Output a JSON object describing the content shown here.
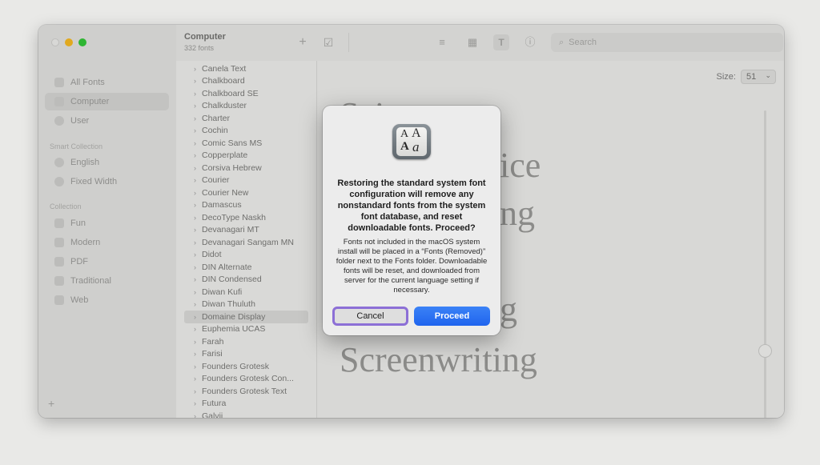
{
  "sidebar": {
    "items": [
      {
        "label": "All Fonts"
      },
      {
        "label": "Computer"
      },
      {
        "label": "User"
      }
    ],
    "smart_heading": "Smart Collection",
    "smart_items": [
      {
        "label": "English"
      },
      {
        "label": "Fixed Width"
      }
    ],
    "collection_heading": "Collection",
    "collection_items": [
      {
        "label": "Fun"
      },
      {
        "label": "Modern"
      },
      {
        "label": "PDF"
      },
      {
        "label": "Traditional"
      },
      {
        "label": "Web"
      }
    ],
    "add_label": "+"
  },
  "toolbar": {
    "title": "Computer",
    "subtitle": "332 fonts",
    "add_label": "+",
    "check_label": "☑",
    "search_placeholder": "Search"
  },
  "font_list": [
    "Canela Text",
    "Chalkboard",
    "Chalkboard SE",
    "Chalkduster",
    "Charter",
    "Cochin",
    "Comic Sans MS",
    "Copperplate",
    "Corsiva Hebrew",
    "Courier",
    "Courier New",
    "Damascus",
    "DecoType Naskh",
    "Devanagari MT",
    "Devanagari Sangam MN",
    "Didot",
    "DIN Alternate",
    "DIN Condensed",
    "Diwan Kufi",
    "Diwan Thuluth",
    "Domaine Display",
    "Euphemia UCAS",
    "Farah",
    "Farisi",
    "Founders Grotesk",
    "Founders Grotesk Con...",
    "Founders Grotesk Text",
    "Futura",
    "Galvji"
  ],
  "preview": {
    "size_label": "Size:",
    "size_value": "51",
    "line1": "Sci",
    "line2": "ice",
    "line3": "ng",
    "line4": "g",
    "line5": "Screenwriting"
  },
  "dialog": {
    "title": "Restoring the standard system font configuration will remove any nonstandard fonts from the system font database, and reset downloadable fonts. Proceed?",
    "body": "Fonts not included in the macOS system install will be placed in a “Fonts (Removed)” folder next to the Fonts folder.  Downloadable fonts will be reset, and downloaded from server for the current language setting if necessary.",
    "cancel_label": "Cancel",
    "proceed_label": "Proceed"
  },
  "colors": {
    "proceed_blue": "#1f64ee",
    "focus_ring": "#8c6fd6",
    "traffic_yellow": "#e1a91f",
    "traffic_green": "#2eb532"
  }
}
